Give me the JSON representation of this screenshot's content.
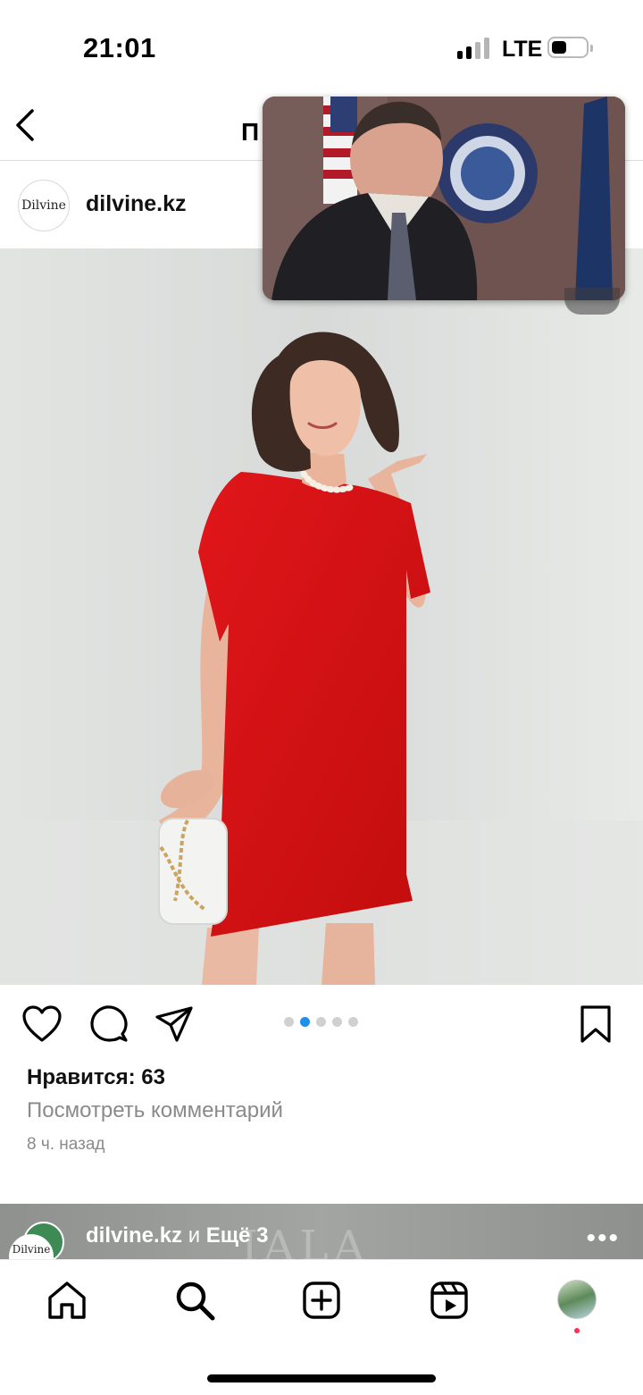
{
  "status_bar": {
    "time": "21:01",
    "carrier": "LTE"
  },
  "nav": {
    "title": "П"
  },
  "post": {
    "avatar_text": "Dilvine",
    "username": "dilvine.kz",
    "likes": "Нравится: 63",
    "view_comments": "Посмотреть комментарий",
    "time_ago": "8 ч. назад",
    "carousel": {
      "total": 5,
      "active_index": 1
    },
    "colors": {
      "dress": "#d6110f",
      "accent": "#1f8fec"
    }
  },
  "next_post": {
    "username": "dilvine.kz",
    "and": " и ",
    "others": "Ещё 3",
    "avatar_text": "Dilvine",
    "watermark": "IALA",
    "more": "•••"
  },
  "icons": {
    "like": "heart-icon",
    "comment": "comment-icon",
    "share": "send-icon",
    "save": "bookmark-icon",
    "home": "home-icon",
    "search": "search-icon",
    "create": "add-post-icon",
    "reels": "reels-icon"
  }
}
